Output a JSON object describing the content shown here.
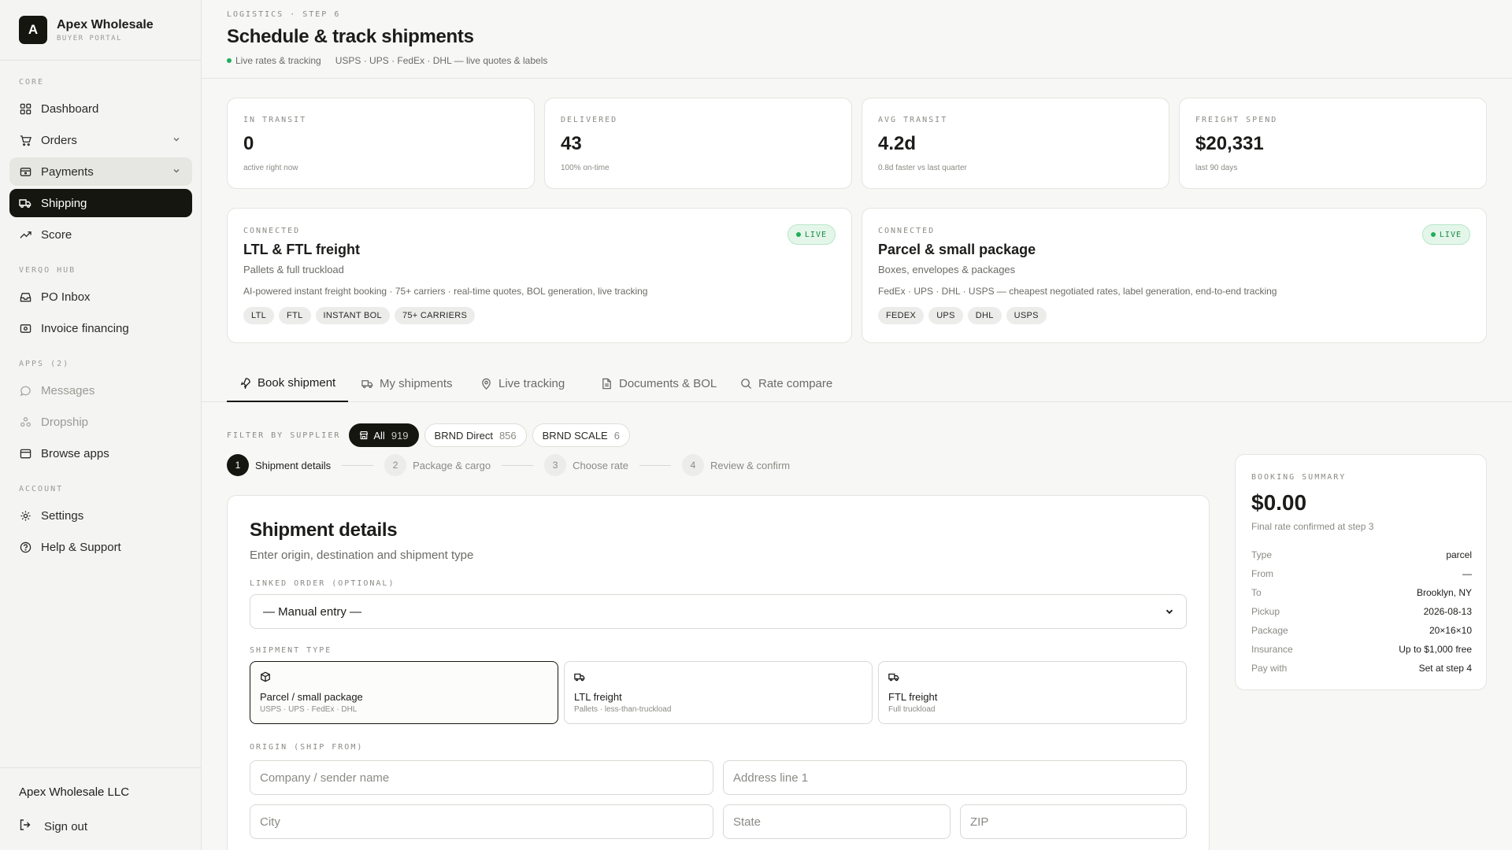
{
  "brand": {
    "logo_letter": "A",
    "name": "Apex Wholesale",
    "sub": "BUYER PORTAL"
  },
  "sidebar": {
    "sections": [
      "CORE",
      "VERQO HUB",
      "APPS (2)",
      "ACCOUNT"
    ],
    "items": [
      {
        "label": "Dashboard",
        "icon": "grid-icon"
      },
      {
        "label": "Orders",
        "icon": "cart-icon"
      },
      {
        "label": "Payments",
        "icon": "card-icon"
      },
      {
        "label": "Shipping",
        "icon": "truck-icon"
      },
      {
        "label": "Score",
        "icon": "trend-icon"
      },
      {
        "label": "PO Inbox",
        "icon": "inbox-icon"
      },
      {
        "label": "Invoice financing",
        "icon": "invoice-icon"
      },
      {
        "label": "Messages",
        "icon": "message-icon"
      },
      {
        "label": "Dropship",
        "icon": "dropship-icon"
      },
      {
        "label": "Browse apps",
        "icon": "apps-icon"
      },
      {
        "label": "Settings",
        "icon": "gear-icon"
      },
      {
        "label": "Help & Support",
        "icon": "help-icon"
      }
    ],
    "org": "Apex Wholesale LLC",
    "signout": "Sign out"
  },
  "header": {
    "crumb": "LOGISTICS · STEP 6",
    "title": "Schedule & track shipments",
    "status": "Live rates & tracking",
    "carriers": "USPS · UPS · FedEx · DHL — live quotes & labels"
  },
  "stats": [
    {
      "label": "IN TRANSIT",
      "value": "0",
      "note": "active right now"
    },
    {
      "label": "DELIVERED",
      "value": "43",
      "note": "100% on-time"
    },
    {
      "label": "AVG TRANSIT",
      "value": "4.2d",
      "note": "0.8d faster vs last quarter"
    },
    {
      "label": "FREIGHT SPEND",
      "value": "$20,331",
      "note": "last 90 days"
    }
  ],
  "connectors": [
    {
      "label": "CONNECTED",
      "name": "LTL & FTL freight",
      "sub": "Pallets & full truckload",
      "desc": "AI-powered instant freight booking · 75+ carriers · real-time quotes, BOL generation, live tracking",
      "badge": "LIVE",
      "tags": [
        "LTL",
        "FTL",
        "INSTANT BOL",
        "75+ CARRIERS"
      ]
    },
    {
      "label": "CONNECTED",
      "name": "Parcel & small package",
      "sub": "Boxes, envelopes & packages",
      "desc": "FedEx · UPS · DHL · USPS — cheapest negotiated rates, label generation, end-to-end tracking",
      "badge": "LIVE",
      "tags": [
        "FEDEX",
        "UPS",
        "DHL",
        "USPS"
      ]
    }
  ],
  "tabs": [
    {
      "label": "Book shipment",
      "icon": "rocket-icon"
    },
    {
      "label": "My shipments",
      "icon": "truck-icon"
    },
    {
      "label": "Live tracking",
      "icon": "pin-icon"
    },
    {
      "label": "Documents & BOL",
      "icon": "document-icon"
    },
    {
      "label": "Rate compare",
      "icon": "search-icon"
    }
  ],
  "filter": {
    "label": "FILTER BY SUPPLIER",
    "chips": [
      {
        "label": "All",
        "count": "919"
      },
      {
        "label": "BRND Direct",
        "count": "856"
      },
      {
        "label": "BRND SCALE",
        "count": "6"
      }
    ]
  },
  "steps": [
    {
      "num": "1",
      "label": "Shipment details"
    },
    {
      "num": "2",
      "label": "Package & cargo"
    },
    {
      "num": "3",
      "label": "Choose rate"
    },
    {
      "num": "4",
      "label": "Review & confirm"
    }
  ],
  "form": {
    "title": "Shipment details",
    "subtitle": "Enter origin, destination and shipment type",
    "linked_label": "LINKED ORDER (OPTIONAL)",
    "linked_value": "— Manual entry —",
    "type_label": "SHIPMENT TYPE",
    "types": [
      {
        "title": "Parcel / small package",
        "desc": "USPS · UPS · FedEx · DHL"
      },
      {
        "title": "LTL freight",
        "desc": "Pallets · less-than-truckload"
      },
      {
        "title": "FTL freight",
        "desc": "Full truckload"
      }
    ],
    "origin_label": "ORIGIN (SHIP FROM)",
    "placeholders": {
      "company": "Company / sender name",
      "address": "Address line 1",
      "city": "City",
      "state": "State",
      "zip": "ZIP"
    }
  },
  "summary": {
    "label": "BOOKING SUMMARY",
    "amount": "$0.00",
    "note": "Final rate confirmed at step 3",
    "rows": [
      {
        "k": "Type",
        "v": "parcel"
      },
      {
        "k": "From",
        "v": "—"
      },
      {
        "k": "To",
        "v": "Brooklyn, NY"
      },
      {
        "k": "Pickup",
        "v": "2026-08-13"
      },
      {
        "k": "Package",
        "v": "20×16×10"
      },
      {
        "k": "Insurance",
        "v": "Up to $1,000 free"
      },
      {
        "k": "Pay with",
        "v": "Set at step 4"
      }
    ]
  },
  "colors": {
    "accent": "#15160f",
    "live_green": "#1fae5b",
    "background": "#f7f7f5"
  }
}
